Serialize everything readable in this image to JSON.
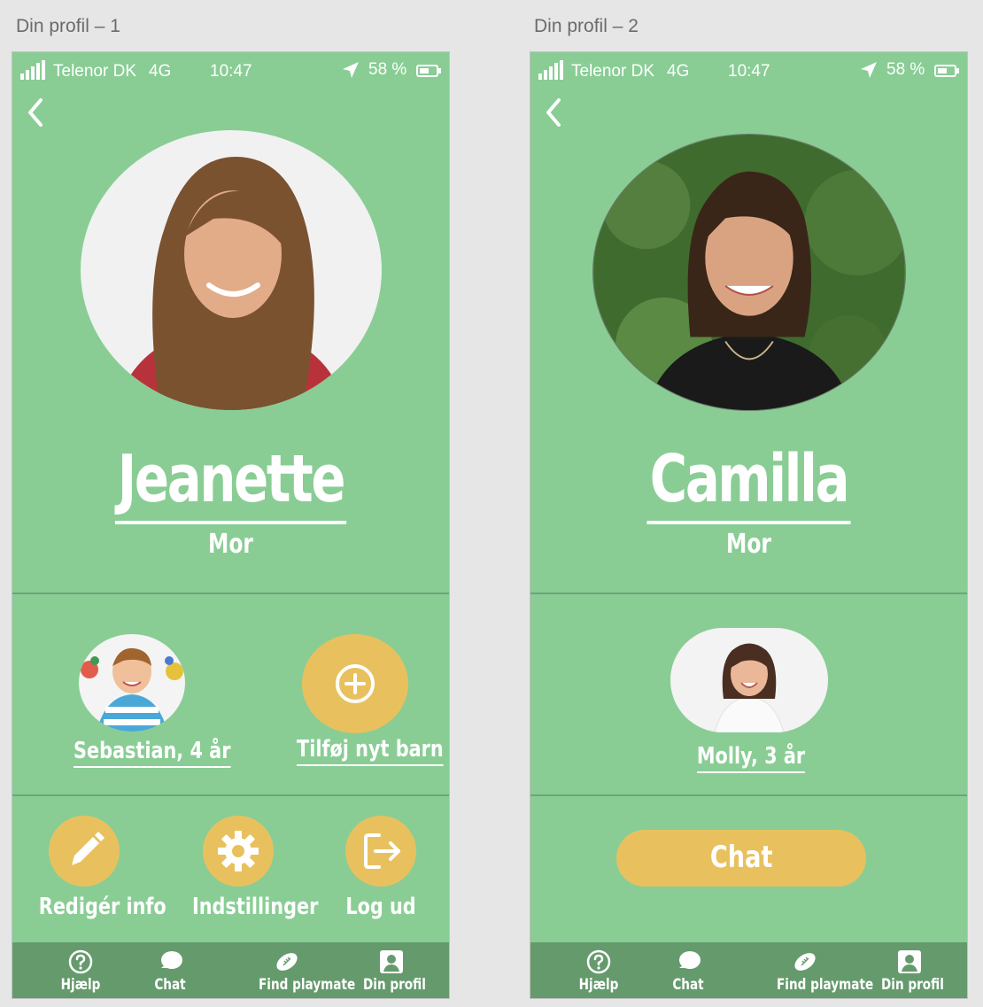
{
  "artboards": [
    {
      "title": "Din profil – 1"
    },
    {
      "title": "Din profil – 2"
    }
  ],
  "status": {
    "carrier": "Telenor DK",
    "network": "4G",
    "time": "10:47",
    "battery": "58 %"
  },
  "profile1": {
    "name": "Jeanette",
    "role": "Mor",
    "child_label": "Sebastian, 4 år",
    "add_child_label": "Tilføj nyt barn",
    "actions": [
      {
        "label": "Redigér info",
        "icon": "pencil-icon"
      },
      {
        "label": "Indstillinger",
        "icon": "gear-icon"
      },
      {
        "label": "Log ud",
        "icon": "logout-icon"
      }
    ]
  },
  "profile2": {
    "name": "Camilla",
    "role": "Mor",
    "child_label": "Molly, 3 år",
    "chat_button": "Chat"
  },
  "tabbar": [
    {
      "label": "Hjælp",
      "icon": "help-icon"
    },
    {
      "label": "Chat",
      "icon": "chat-bubble-icon"
    },
    {
      "label": "Find playmate",
      "icon": "football-icon"
    },
    {
      "label": "Din profil",
      "icon": "profile-icon"
    }
  ],
  "colors": {
    "background": "#89cd95",
    "accent": "#e8c15e",
    "tabbar": "#659a6d",
    "divider": "#6fa37a"
  }
}
